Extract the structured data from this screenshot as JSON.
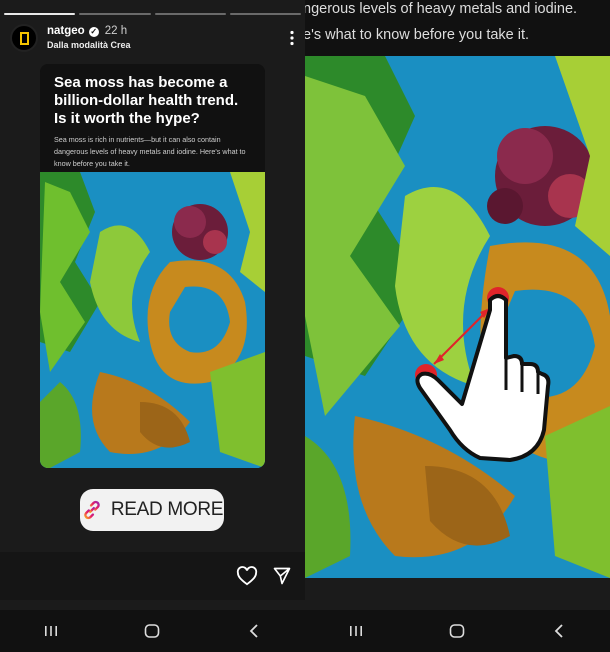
{
  "story": {
    "username": "natgeo",
    "time": "22 h",
    "subtitle": "Dalla modalità Crea",
    "progress_segments": 4,
    "progress_active": 1,
    "verified": true
  },
  "card": {
    "headline": "Sea moss has become a billion-dollar health trend. Is it worth the hype?",
    "subtext": "Sea moss is rich in nutrients—but it can also contain dangerous levels of heavy metals and iodine. Here's what to know before you take it."
  },
  "cta": {
    "label": "READ MORE",
    "icon": "link-icon"
  },
  "actions": {
    "like_icon": "heart-icon",
    "share_icon": "send-icon"
  },
  "nav": {
    "recent_icon": "recent-apps-icon",
    "home_icon": "home-icon",
    "back_icon": "back-icon"
  },
  "zoomed": {
    "caption_line1": "ngerous levels of heavy metals and iodine.",
    "caption_line2": "e's what to know before you take it.",
    "gesture": "pinch-zoom-hand-icon"
  },
  "colors": {
    "brand_yellow": "#f5c400",
    "water_blue": "#1a8fc2",
    "gesture_red": "#e0242a"
  }
}
